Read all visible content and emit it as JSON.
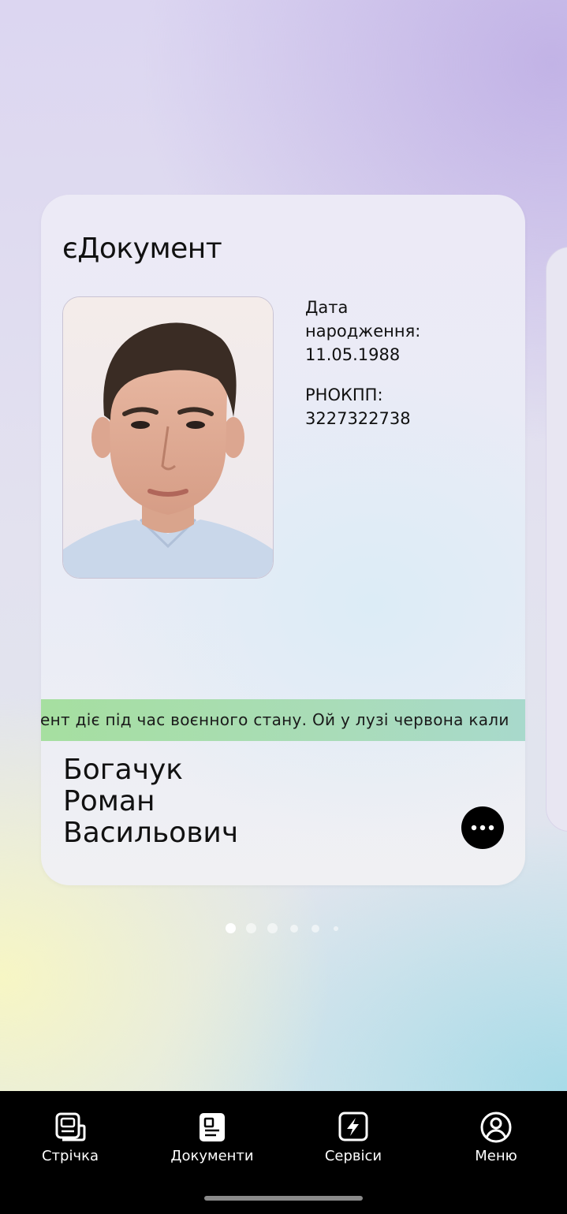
{
  "card": {
    "title": "єДокумент",
    "dob_label": "Дата народження:",
    "dob_value": "11.05.1988",
    "tax_label": "РНОКПП:",
    "tax_value": "3227322738",
    "ticker_text": "ент діє під час воєнного стану. Ой у лузі червона кали",
    "name_line1": "Богачук",
    "name_line2": "Роман",
    "name_line3": "Васильович",
    "more_icon": "more-horizontal-icon",
    "photo_icon": "portrait-photo"
  },
  "pagination": {
    "total": 6,
    "active_index": 0
  },
  "nav": {
    "items": [
      {
        "label": "Стрічка",
        "icon": "feed-icon"
      },
      {
        "label": "Документи",
        "icon": "documents-icon",
        "active": true
      },
      {
        "label": "Сервіси",
        "icon": "services-lightning-icon"
      },
      {
        "label": "Меню",
        "icon": "profile-menu-icon"
      }
    ]
  },
  "colors": {
    "navbar_bg": "#000000",
    "ticker_green": "#a6dfa0",
    "text_primary": "#111111"
  }
}
